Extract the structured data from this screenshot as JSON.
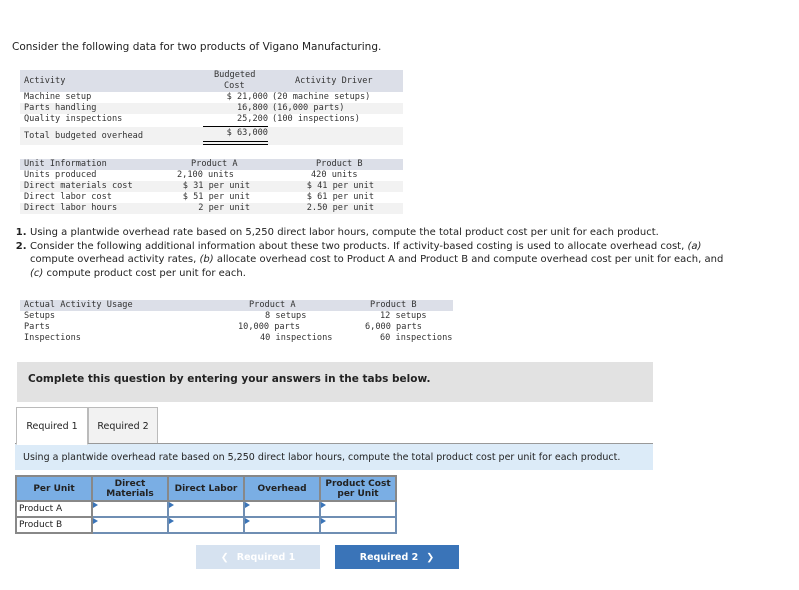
{
  "intro": "Consider the following data for two products of Vigano Manufacturing.",
  "activity_table": {
    "headers": [
      "Activity",
      "Budgeted",
      "Cost",
      "Activity Driver"
    ],
    "rows": [
      {
        "activity": "Machine setup",
        "cost": "$ 21,000",
        "driver": "(20 machine setups)"
      },
      {
        "activity": "Parts handling",
        "cost": "16,800",
        "driver": "(16,000 parts)"
      },
      {
        "activity": "Quality inspections",
        "cost": "25,200",
        "driver": "(100 inspections)"
      },
      {
        "activity": "Total budgeted overhead",
        "cost": "$ 63,000",
        "driver": ""
      }
    ]
  },
  "unit_table": {
    "headers": [
      "Unit Information",
      "Product A",
      "Product B"
    ],
    "rows": [
      [
        "Units produced",
        "2,100 units",
        "420 units"
      ],
      [
        "Direct materials cost",
        "$ 31 per unit",
        "$ 41 per unit"
      ],
      [
        "Direct labor cost",
        "$ 51 per unit",
        "$ 61 per unit"
      ],
      [
        "Direct labor hours",
        "2 per unit",
        "2.50 per unit"
      ]
    ]
  },
  "questions": [
    "Using a plantwide overhead rate based on 5,250 direct labor hours, compute the total product cost per unit for each product.",
    "Consider the following additional information about these two products. If activity-based costing is used to allocate overhead cost, (a) compute overhead activity rates, (b) allocate overhead cost to Product A and Product B and compute overhead cost per unit for each, and (c) compute product cost per unit for each."
  ],
  "usage_table": {
    "headers": [
      "Actual Activity Usage",
      "Product A",
      "Product B"
    ],
    "rows": [
      [
        "Setups",
        "8 setups",
        "12 setups"
      ],
      [
        "Parts",
        "10,000 parts",
        "6,000 parts"
      ],
      [
        "Inspections",
        "40 inspections",
        "60 inspections"
      ]
    ]
  },
  "complete_prompt": "Complete this question by entering your answers in the tabs below.",
  "tabs": [
    "Required 1",
    "Required 2"
  ],
  "instruction": "Using a plantwide overhead rate based on 5,250 direct labor hours, compute the total product cost per unit for each product.",
  "answer_table": {
    "headers": [
      "Per Unit",
      "Direct Materials",
      "Direct Labor",
      "Overhead",
      "Product Cost per Unit"
    ],
    "rows": [
      "Product A",
      "Product B"
    ]
  },
  "nav": {
    "prev": "Required 1",
    "next": "Required 2"
  }
}
